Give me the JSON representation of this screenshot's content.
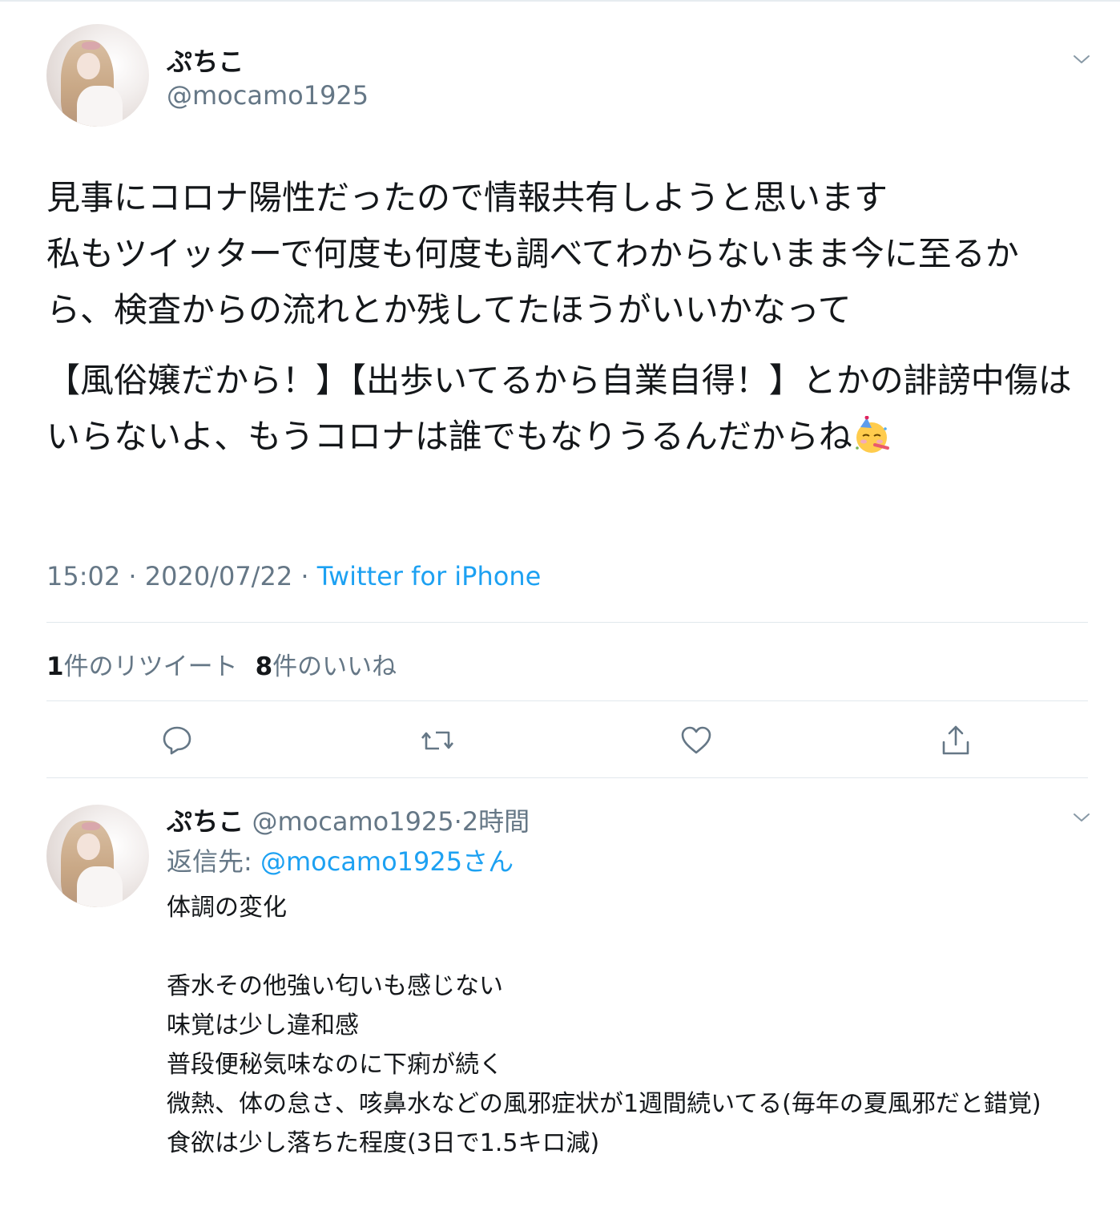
{
  "tweet": {
    "author_name": "ぷちこ",
    "author_handle": "@mocamo1925",
    "paragraphs": [
      "見事にコロナ陽性だったので情報共有しようと思います\n私もツイッターで何度も何度も調べてわからないまま今に至るから、検査からの流れとか残してたほうがいいかなって",
      "【風俗嬢だから！】【出歩いてるから自業自得！】とかの誹謗中傷はいらないよ、もうコロナは誰でもなりうるんだからね"
    ],
    "time": "15:02",
    "date": "2020/07/22",
    "separator": "·",
    "source": "Twitter for iPhone",
    "retweet_count": "1",
    "retweet_label": "件のリツイート",
    "like_count": "8",
    "like_label": "件のいいね",
    "emoji_icon": "partying-face-emoji",
    "actions": [
      "reply-icon",
      "retweet-icon",
      "like-icon",
      "share-icon"
    ]
  },
  "reply": {
    "author_name": "ぷちこ",
    "author_handle": "@mocamo1925",
    "separator": "·",
    "age": "2時間",
    "replying_to_label": "返信先: ",
    "replying_to_handle": "@mocamo1925さん",
    "lines": [
      "体調の変化",
      "",
      "香水その他強い匂いも感じない",
      "味覚は少し違和感",
      "普段便秘気味なのに下痢が続く",
      "微熱、体の怠さ、咳鼻水などの風邪症状が1週間続いてる(毎年の夏風邪だと錯覚)",
      "食欲は少し落ちた程度(3日で1.5キロ減)"
    ]
  },
  "colors": {
    "text": "#14171a",
    "secondary": "#657786",
    "link": "#1da1f2",
    "divider": "#e1e8ed"
  }
}
